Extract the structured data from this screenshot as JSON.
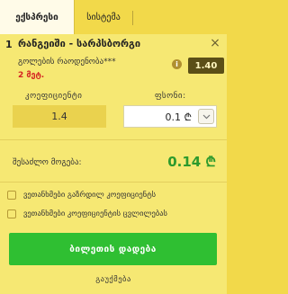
{
  "tabs": [
    {
      "label": "ექსპრესი"
    },
    {
      "label": "სისტემა"
    }
  ],
  "bet": {
    "index": "1",
    "match": "რანგეიში - სარპსბორგი",
    "market": "გოლების რაოდენობა***",
    "price": "2 მეტ.",
    "odds": "1.40"
  },
  "labels": {
    "coefficient": "კოეფიციენტი",
    "stake": "ფსონი:",
    "possible_win": "შესაძლო მოგება:"
  },
  "inputs": {
    "coefficient_value": "1.4",
    "stake_value": "0.1 ₾"
  },
  "possible_win_value": "0.14 ₾",
  "options": [
    {
      "label": "ვეთანხმები გაზრდილ კოეფიციენტს"
    },
    {
      "label": "ვეთანხმები კოეფიციენტის ცვლილებას"
    }
  ],
  "actions": {
    "place_bet": "ბილეთის დადება",
    "clear": "გაუქმება"
  },
  "colors": {
    "accent_green": "#2fbf32",
    "price_red": "#d42222",
    "background_yellow": "#f2d94a"
  }
}
